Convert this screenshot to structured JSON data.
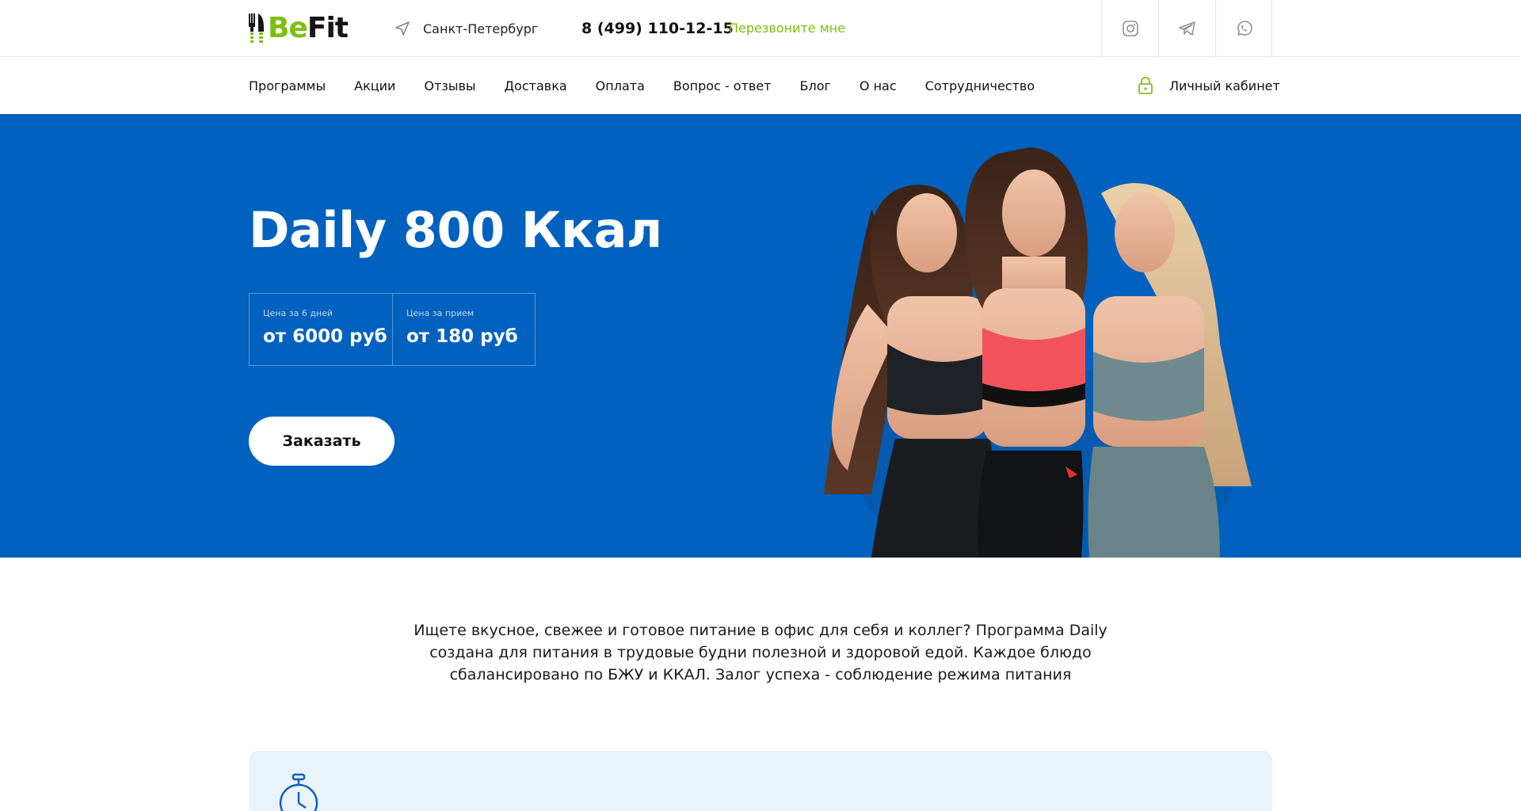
{
  "header": {
    "logo": {
      "part1": "Be",
      "part2": "Fit"
    },
    "city": "Санкт-Петербург",
    "phone": "8 (499) 110-12-15",
    "callback": "Перезвоните мне",
    "socials": [
      {
        "icon": "instagram-icon"
      },
      {
        "icon": "telegram-icon"
      },
      {
        "icon": "whatsapp-icon"
      }
    ]
  },
  "nav": {
    "items": [
      {
        "label": "Программы"
      },
      {
        "label": "Акции"
      },
      {
        "label": "Отзывы"
      },
      {
        "label": "Доставка"
      },
      {
        "label": "Оплата"
      },
      {
        "label": "Вопрос - ответ"
      },
      {
        "label": "Блог"
      },
      {
        "label": "О нас"
      },
      {
        "label": "Сотрудничество"
      }
    ],
    "account": "Личный кабинет"
  },
  "hero": {
    "title": "Daily 800 Ккал",
    "prices": [
      {
        "label": "Цена за 6 дней",
        "value": "от 6000 руб"
      },
      {
        "label": "Цена за прием",
        "value": "от 180 руб"
      }
    ],
    "order_button": "Заказать"
  },
  "description": "Ищете вкусное, свежее и готовое питание в офис для себя и коллег? Программа Daily создана для питания в трудовые будни полезной и здоровой едой. Каждое блюдо сбалансировано по БЖУ и ККАЛ. Залог успеха - соблюдение режима питания",
  "colors": {
    "brand_green": "#7cc00f",
    "hero_blue": "#0161be",
    "card_bg": "#eaf2fa"
  }
}
